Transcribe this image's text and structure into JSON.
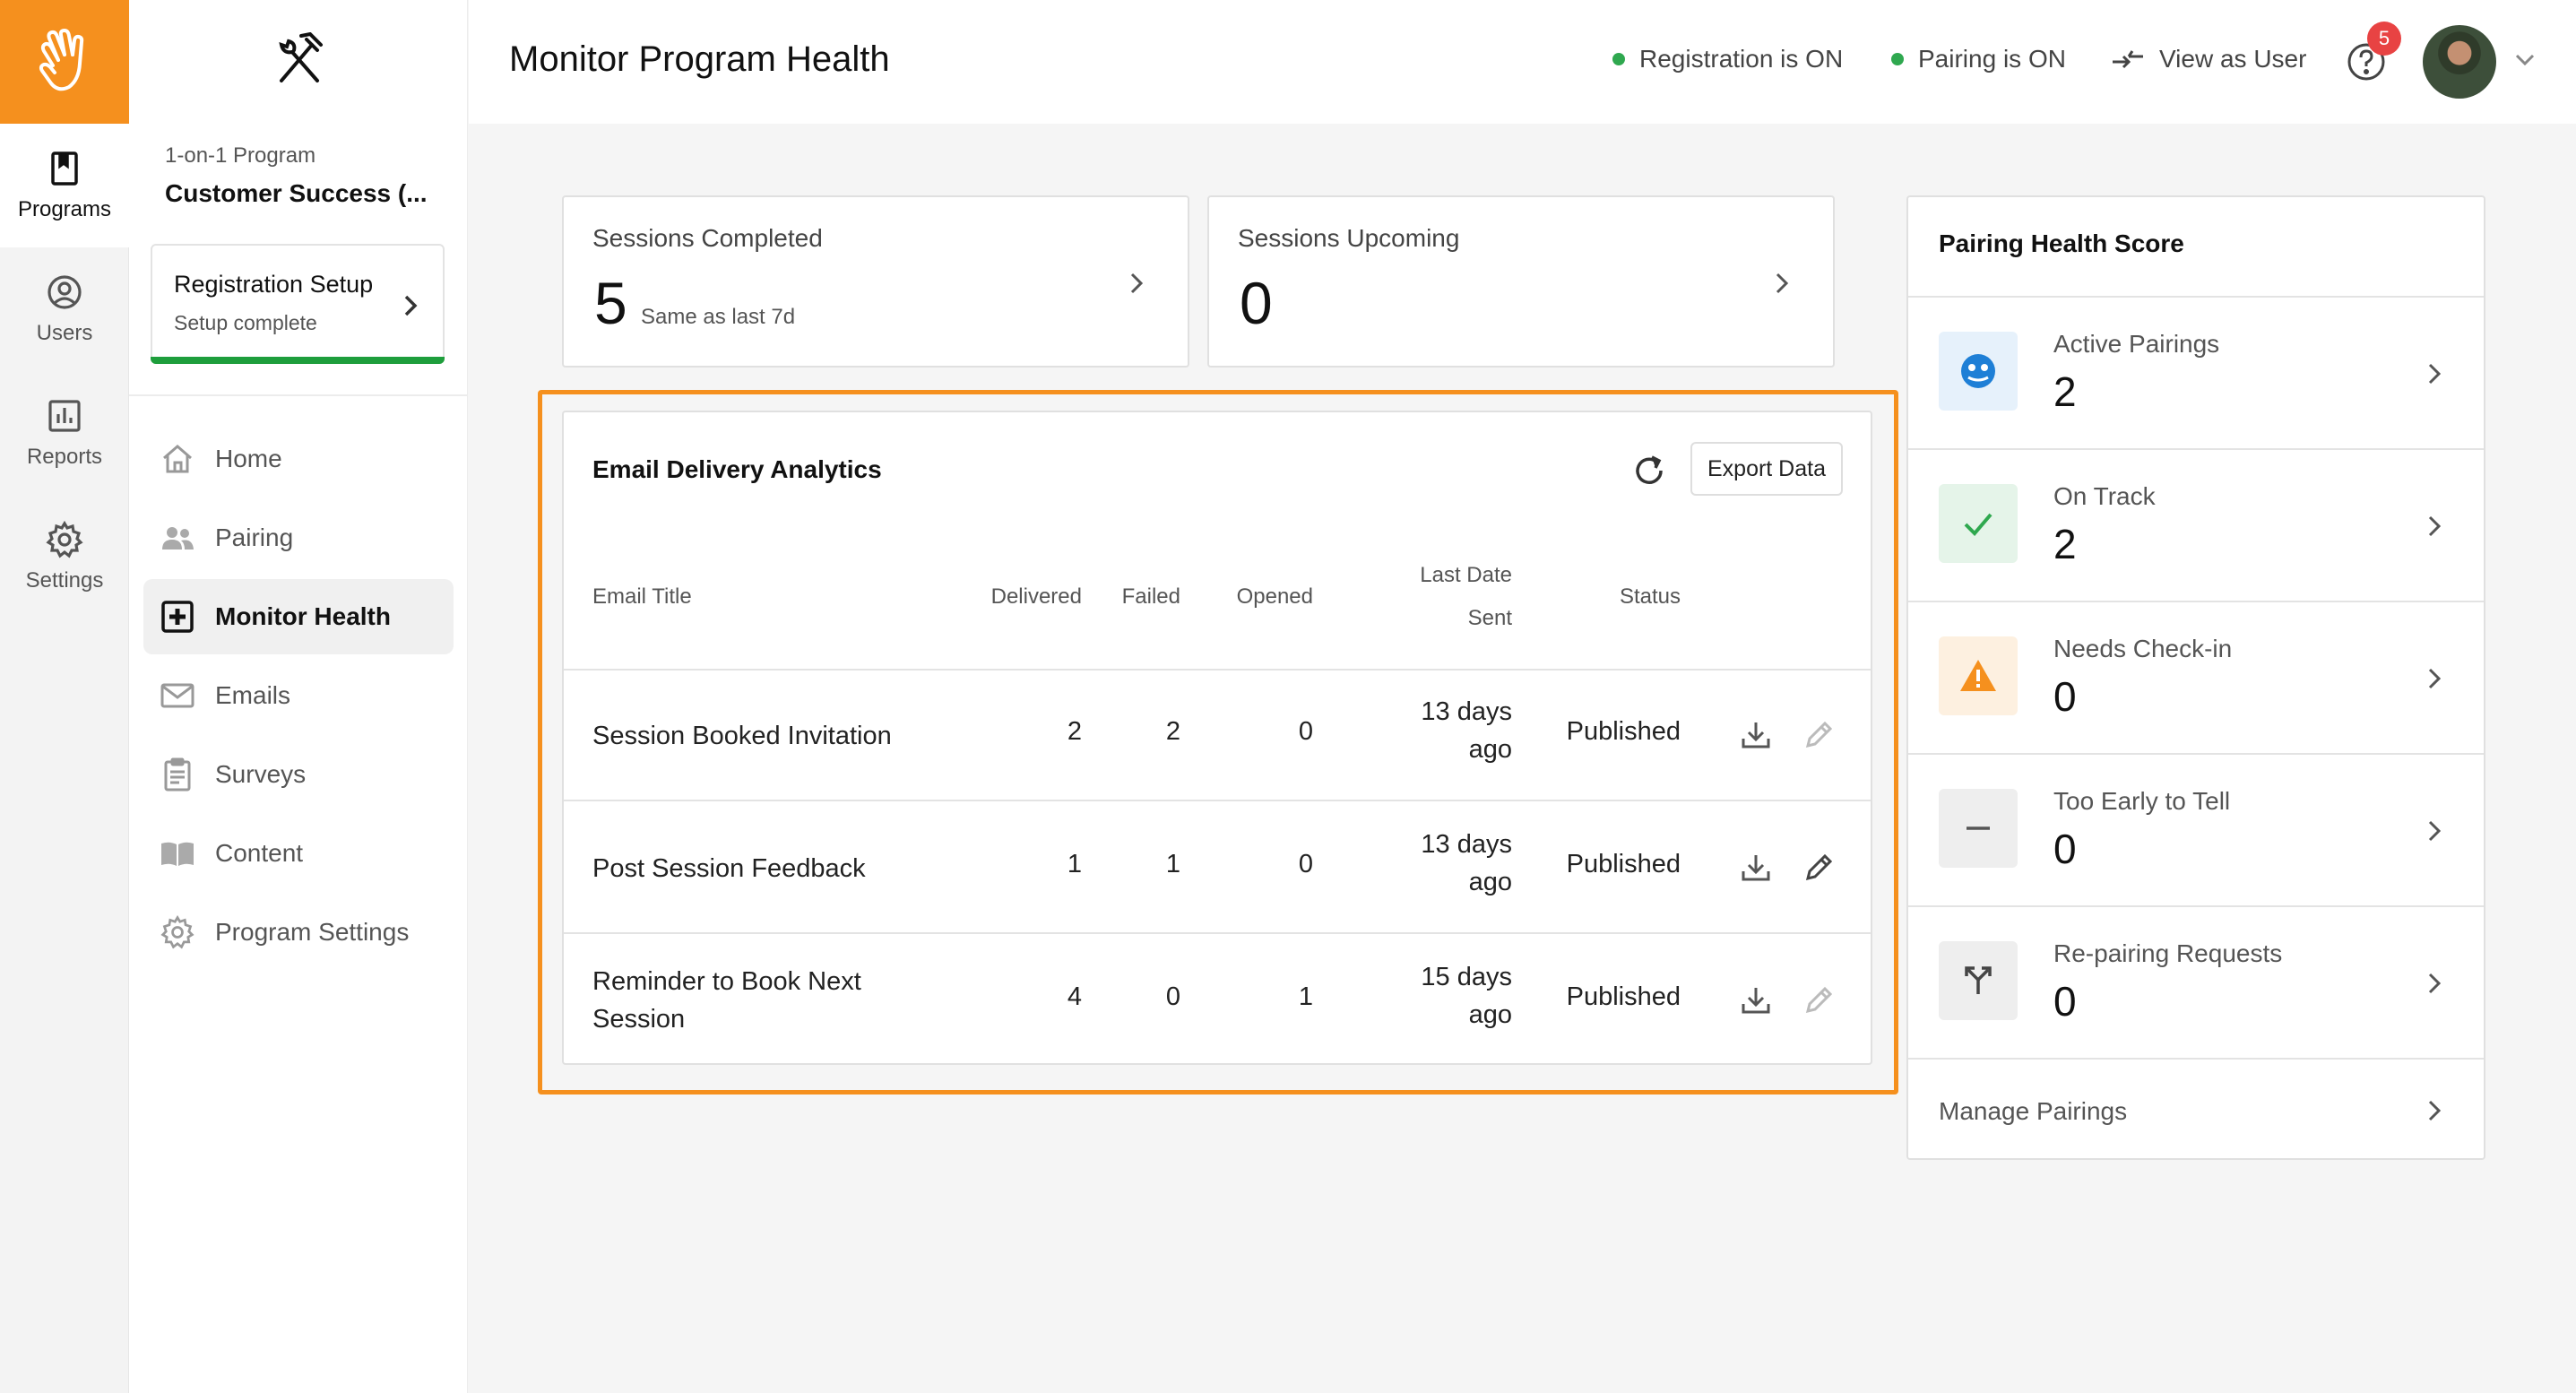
{
  "rail": {
    "items": [
      {
        "label": "Programs",
        "icon": "bookmark-book-icon"
      },
      {
        "label": "Users",
        "icon": "user-circle-icon"
      },
      {
        "label": "Reports",
        "icon": "bar-chart-icon"
      },
      {
        "label": "Settings",
        "icon": "gear-icon"
      }
    ]
  },
  "sidebar": {
    "program_small": "1-on-1 Program",
    "program_name": "Customer Success (...",
    "setup_card": {
      "title": "Registration Setup",
      "subtitle": "Setup complete",
      "progress": 1.0
    },
    "nav": [
      {
        "label": "Home",
        "icon": "home-icon"
      },
      {
        "label": "Pairing",
        "icon": "people-icon"
      },
      {
        "label": "Monitor Health",
        "icon": "plus-square-icon"
      },
      {
        "label": "Emails",
        "icon": "envelope-icon"
      },
      {
        "label": "Surveys",
        "icon": "clipboard-icon"
      },
      {
        "label": "Content",
        "icon": "open-book-icon"
      },
      {
        "label": "Program Settings",
        "icon": "gear-icon"
      }
    ]
  },
  "header": {
    "title": "Monitor Program Health",
    "registration": "Registration is ON",
    "pairing": "Pairing is ON",
    "view_as_user": "View as User",
    "notification_count": "5"
  },
  "stats": {
    "completed": {
      "label": "Sessions Completed",
      "value": "5",
      "note": "Same as last 7d"
    },
    "upcoming": {
      "label": "Sessions Upcoming",
      "value": "0"
    }
  },
  "email_analytics": {
    "title": "Email Delivery Analytics",
    "export_label": "Export Data",
    "columns": {
      "title": "Email Title",
      "delivered": "Delivered",
      "failed": "Failed",
      "opened": "Opened",
      "last_sent_1": "Last Date",
      "last_sent_2": "Sent",
      "status": "Status"
    },
    "rows": [
      {
        "title": "Session Booked Invitation",
        "delivered": "2",
        "failed": "2",
        "opened": "0",
        "last_1": "13 days",
        "last_2": "ago",
        "status": "Published"
      },
      {
        "title": "Post Session Feedback",
        "delivered": "1",
        "failed": "1",
        "opened": "0",
        "last_1": "13 days",
        "last_2": "ago",
        "status": "Published"
      },
      {
        "title": "Reminder to Book Next Session",
        "delivered": "4",
        "failed": "0",
        "opened": "1",
        "last_1": "15 days",
        "last_2": "ago",
        "status": "Published"
      }
    ]
  },
  "pairing_health": {
    "title": "Pairing Health Score",
    "items": [
      {
        "label": "Active Pairings",
        "value": "2",
        "icon": "pairing-face-icon",
        "color": "#1e7fd6"
      },
      {
        "label": "On Track",
        "value": "2",
        "icon": "check-icon",
        "color": "#2fa84f"
      },
      {
        "label": "Needs Check-in",
        "value": "0",
        "icon": "warning-icon",
        "color": "#f5901e"
      },
      {
        "label": "Too Early to Tell",
        "value": "0",
        "icon": "minus-icon",
        "color": "#555555"
      },
      {
        "label": "Re-pairing Requests",
        "value": "0",
        "icon": "split-arrows-icon",
        "color": "#555555"
      }
    ],
    "manage_label": "Manage Pairings"
  },
  "colors": {
    "brand": "#f5901e",
    "success": "#2fa84f",
    "alert": "#e84343"
  }
}
